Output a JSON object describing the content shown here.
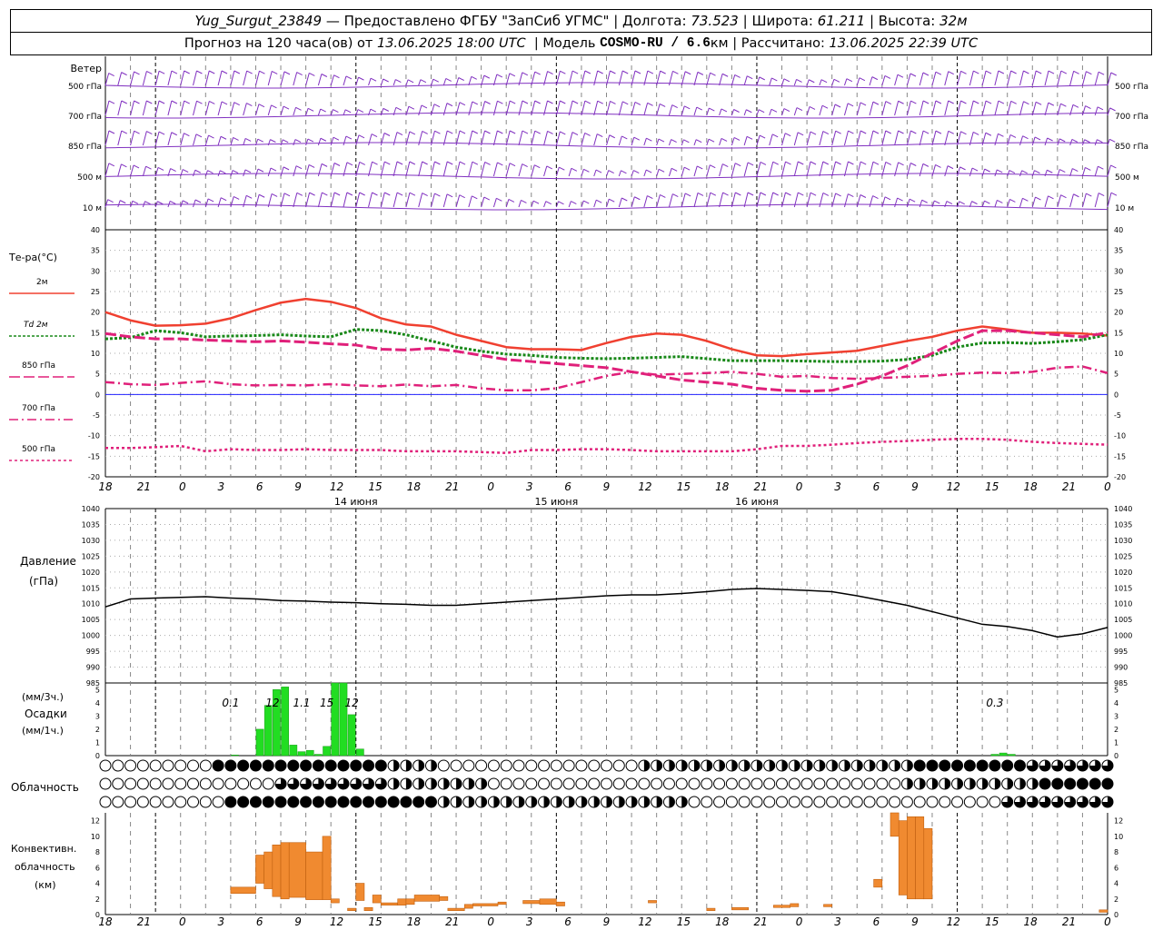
{
  "header": {
    "station": "Yug_Surgut_23849",
    "provider": "— Предоставлено ФГБУ \"ЗапСиб УГМС\"",
    "lon_label": "Долгота:",
    "lon": "73.523",
    "lat_label": "Широта:",
    "lat": "61.211",
    "alt_label": "Высота:",
    "alt": "32м",
    "forecast_prefix": "Прогноз на 120 часа(ов) от",
    "forecast_time": "13.06.2025 18:00 UTC",
    "model_label": "Модель",
    "model": "COSMO-RU / 6.6",
    "model_unit": "км",
    "calc_label": "Рассчитано:",
    "calc_time": "13.06.2025 22:39 UTC"
  },
  "colors": {
    "wind": "#8030c0",
    "t2m": "#f04030",
    "td2m": "#188818",
    "t850": "#e0207a",
    "precip": "#22dd22",
    "conv": "#f08a30",
    "pressure": "#000000",
    "zero_line": "#2020ff"
  },
  "time_axis": {
    "ticks": [
      "18",
      "21",
      "0",
      "3",
      "6",
      "9",
      "12",
      "15",
      "18",
      "21",
      "0",
      "3",
      "6",
      "9",
      "12",
      "15",
      "18",
      "21",
      "0",
      "3",
      "6",
      "9",
      "12",
      "15",
      "18",
      "21",
      "0"
    ],
    "days": [
      "14 июня",
      "15 июня",
      "16 июня"
    ]
  },
  "wind": {
    "title": "Ветер",
    "levels": [
      "500 гПа",
      "700 гПа",
      "850 гПа",
      "500 м",
      "10 м"
    ]
  },
  "temperature": {
    "ylabel": "Те-ра(°C)",
    "ylim": [
      -20,
      40
    ],
    "ticks": [
      40,
      35,
      30,
      25,
      20,
      15,
      10,
      5,
      0,
      -5,
      -10,
      -15,
      -20
    ],
    "legend": [
      "2м",
      "Td 2м",
      "850 гПа",
      "700 гПа",
      "500 гПа"
    ]
  },
  "pressure": {
    "ylabel": "Давление",
    "unit": "(гПа)",
    "ylim": [
      985,
      1040
    ],
    "ticks": [
      1040,
      1035,
      1030,
      1025,
      1020,
      1015,
      1010,
      1005,
      1000,
      995,
      990,
      985
    ]
  },
  "precip": {
    "ylabel1": "(мм/3ч.)",
    "ylabel2": "Осадки",
    "ylabel3": "(мм/1ч.)",
    "ylim": [
      0,
      5.5
    ],
    "ticks": [
      5,
      4,
      3,
      2,
      1,
      0
    ],
    "labels": [
      {
        "text": "0.1",
        "hour": 15
      },
      {
        "text": "12",
        "hour": 20
      },
      {
        "text": "1.1",
        "hour": 23.5
      },
      {
        "text": "15",
        "hour": 26.5
      },
      {
        "text": "12",
        "hour": 29.5
      },
      {
        "text": "0.3",
        "hour": 106.5
      }
    ]
  },
  "clouds": {
    "label": "Облачность",
    "rows": 3
  },
  "convective": {
    "ylabel1": "Конвективн.",
    "ylabel2": "облачность",
    "ylabel3": "(км)",
    "ylim": [
      0,
      13
    ],
    "ticks": [
      12,
      10,
      8,
      6,
      4,
      2,
      0
    ]
  },
  "chart_data": [
    {
      "type": "line",
      "name": "temperature",
      "x_unit": "hours since 13.06.2025 18:00 UTC",
      "series": [
        {
          "name": "2м",
          "x": [
            0,
            3,
            6,
            9,
            12,
            15,
            18,
            21,
            24,
            27,
            30,
            33,
            36,
            39,
            42,
            45,
            48,
            51,
            54,
            57,
            60,
            63,
            66,
            69,
            72,
            75,
            78,
            81,
            84,
            87,
            90,
            93,
            96,
            99,
            102,
            105,
            108,
            111,
            114,
            117,
            120
          ],
          "values": [
            20,
            18,
            16.7,
            16.8,
            17.2,
            18.5,
            20.5,
            22.3,
            23.2,
            22.5,
            21,
            18.5,
            17,
            16.5,
            14.5,
            13,
            11.5,
            11,
            11,
            10.8,
            12.5,
            14,
            14.8,
            14.5,
            13,
            11,
            9.5,
            9.3,
            9.8,
            10.2,
            10.6,
            11.8,
            13,
            14,
            15.5,
            16.5,
            15.8,
            15,
            15,
            14.8,
            14.3
          ]
        },
        {
          "name": "Td 2м",
          "x": [
            0,
            3,
            6,
            9,
            12,
            15,
            18,
            21,
            24,
            27,
            30,
            33,
            36,
            39,
            42,
            45,
            48,
            51,
            54,
            57,
            60,
            63,
            66,
            69,
            72,
            75,
            78,
            81,
            84,
            87,
            90,
            93,
            96,
            99,
            102,
            105,
            108,
            111,
            114,
            117,
            120
          ],
          "values": [
            13.5,
            13.8,
            15.5,
            15,
            14,
            14.2,
            14.3,
            14.5,
            14.2,
            14,
            15.8,
            15.5,
            14.5,
            13,
            11.5,
            10.5,
            9.8,
            9.5,
            9,
            8.8,
            8.7,
            8.8,
            9,
            9.2,
            8.7,
            8.2,
            8.2,
            8.2,
            8.1,
            8,
            8,
            8.1,
            8.5,
            9.5,
            11.5,
            12.5,
            12.6,
            12.4,
            12.8,
            13.3,
            14.5
          ]
        },
        {
          "name": "850 гПа",
          "x": [
            0,
            3,
            6,
            9,
            12,
            15,
            18,
            21,
            24,
            27,
            30,
            33,
            36,
            39,
            42,
            45,
            48,
            51,
            54,
            57,
            60,
            63,
            66,
            69,
            72,
            75,
            78,
            81,
            84,
            87,
            90,
            93,
            96,
            99,
            102,
            105,
            108,
            111,
            114,
            117,
            120
          ],
          "values": [
            14.8,
            14,
            13.5,
            13.5,
            13.2,
            13,
            12.8,
            13,
            12.7,
            12.3,
            12,
            11,
            10.8,
            11.2,
            10.5,
            9.5,
            8.5,
            8,
            7.5,
            7,
            6.5,
            5.5,
            4.5,
            3.5,
            3,
            2.5,
            1.5,
            1,
            0.8,
            1,
            2.5,
            4.5,
            7,
            10,
            13,
            15.5,
            15.5,
            15,
            14.5,
            14,
            15
          ]
        },
        {
          "name": "700 гПа",
          "x": [
            0,
            3,
            6,
            9,
            12,
            15,
            18,
            21,
            24,
            27,
            30,
            33,
            36,
            39,
            42,
            45,
            48,
            51,
            54,
            57,
            60,
            63,
            66,
            69,
            72,
            75,
            78,
            81,
            84,
            87,
            90,
            93,
            96,
            99,
            102,
            105,
            108,
            111,
            114,
            117,
            120
          ],
          "values": [
            3,
            2.5,
            2.3,
            2.8,
            3.2,
            2.5,
            2.2,
            2.3,
            2.2,
            2.5,
            2.2,
            2,
            2.4,
            2,
            2.3,
            1.5,
            1,
            1,
            1.5,
            3,
            4.5,
            5.5,
            4.8,
            5,
            5.2,
            5.5,
            5,
            4.3,
            4.5,
            4,
            3.8,
            4,
            4.3,
            4.5,
            5,
            5.3,
            5.2,
            5.5,
            6.5,
            6.8,
            5.2
          ]
        },
        {
          "name": "500 гПа",
          "x": [
            0,
            3,
            6,
            9,
            12,
            15,
            18,
            21,
            24,
            27,
            30,
            33,
            36,
            39,
            42,
            45,
            48,
            51,
            54,
            57,
            60,
            63,
            66,
            69,
            72,
            75,
            78,
            81,
            84,
            87,
            90,
            93,
            96,
            99,
            102,
            105,
            108,
            111,
            114,
            117,
            120
          ],
          "values": [
            -13,
            -13,
            -12.8,
            -12.5,
            -13.8,
            -13.3,
            -13.5,
            -13.5,
            -13.3,
            -13.5,
            -13.5,
            -13.5,
            -13.8,
            -13.8,
            -13.8,
            -14,
            -14.2,
            -13.5,
            -13.5,
            -13.3,
            -13.3,
            -13.5,
            -13.8,
            -13.8,
            -13.8,
            -13.8,
            -13.3,
            -12.5,
            -12.5,
            -12.2,
            -11.8,
            -11.5,
            -11.3,
            -11,
            -10.8,
            -10.8,
            -11,
            -11.5,
            -11.8,
            -12,
            -12.2
          ]
        }
      ]
    },
    {
      "type": "line",
      "name": "pressure",
      "x_unit": "hours since 13.06.2025 18:00 UTC",
      "series": [
        {
          "name": "pressure",
          "x": [
            0,
            3,
            6,
            9,
            12,
            15,
            18,
            21,
            24,
            27,
            30,
            33,
            36,
            39,
            42,
            45,
            48,
            51,
            54,
            57,
            60,
            63,
            66,
            69,
            72,
            75,
            78,
            81,
            84,
            87,
            90,
            93,
            96,
            99,
            102,
            105,
            108,
            111,
            114,
            117,
            120
          ],
          "values": [
            1009,
            1011.5,
            1011.8,
            1012,
            1012.2,
            1011.8,
            1011.5,
            1011,
            1010.8,
            1010.5,
            1010.3,
            1010,
            1009.8,
            1009.5,
            1009.5,
            1010,
            1010.5,
            1011,
            1011.5,
            1012,
            1012.5,
            1012.8,
            1012.8,
            1013.2,
            1013.8,
            1014.5,
            1014.8,
            1014.5,
            1014.2,
            1013.8,
            1012.5,
            1011,
            1009.5,
            1007.5,
            1005.5,
            1003.5,
            1002.8,
            1001.5,
            999.5,
            1000.5,
            1002.5
          ]
        }
      ]
    },
    {
      "type": "bar",
      "name": "precipitation",
      "x_unit": "hours since 13.06.2025 18:00 UTC",
      "x": [
        15,
        18,
        19,
        20,
        21,
        22,
        23,
        24,
        25,
        26,
        27,
        28,
        29,
        30,
        106,
        107,
        108
      ],
      "values": [
        0.05,
        2,
        3.8,
        5,
        5.2,
        0.8,
        0.3,
        0.4,
        0.1,
        0.7,
        5.5,
        5.5,
        3.1,
        0.5,
        0.1,
        0.2,
        0.1
      ]
    },
    {
      "type": "bar",
      "name": "convective",
      "x_unit": "hours since 13.06.2025 18:00 UTC",
      "bars": [
        [
          15,
          18,
          2.7,
          3.5
        ],
        [
          18,
          19,
          4,
          7.6
        ],
        [
          19,
          20,
          3.3,
          8
        ],
        [
          20,
          21,
          2.3,
          8.9
        ],
        [
          21,
          22,
          2,
          9.2
        ],
        [
          22,
          24,
          2.2,
          9.2
        ],
        [
          24,
          26,
          1.9,
          8
        ],
        [
          26,
          27,
          1.9,
          10
        ],
        [
          27,
          28,
          1.5,
          2
        ],
        [
          29,
          30,
          0.5,
          0.8
        ],
        [
          30,
          31,
          1.8,
          4
        ],
        [
          31,
          32,
          0.5,
          0.9
        ],
        [
          32,
          33,
          1.5,
          2.5
        ],
        [
          33,
          35,
          1.2,
          1.5
        ],
        [
          35,
          36,
          1.2,
          2
        ],
        [
          36,
          37,
          1.3,
          2
        ],
        [
          37,
          40,
          1.7,
          2.5
        ],
        [
          40,
          41,
          1.8,
          2.3
        ],
        [
          41,
          43,
          0.5,
          0.8
        ],
        [
          43,
          44,
          0.8,
          1.3
        ],
        [
          44,
          47,
          1.1,
          1.4
        ],
        [
          47,
          48,
          1.3,
          1.6
        ],
        [
          50,
          52,
          1.4,
          1.8
        ],
        [
          52,
          54,
          1.3,
          2
        ],
        [
          54,
          55,
          1.1,
          1.6
        ],
        [
          65,
          66,
          1.5,
          1.8
        ],
        [
          72,
          73,
          0.5,
          0.8
        ],
        [
          75,
          77,
          0.6,
          0.9
        ],
        [
          80,
          82,
          0.9,
          1.2
        ],
        [
          82,
          83,
          1,
          1.4
        ],
        [
          86,
          87,
          1,
          1.3
        ],
        [
          92,
          93,
          3.5,
          4.5
        ],
        [
          94,
          95,
          10,
          13
        ],
        [
          95,
          96,
          2.5,
          12
        ],
        [
          96,
          97,
          2,
          12.5
        ],
        [
          97,
          98,
          2,
          12.5
        ],
        [
          98,
          99,
          2,
          11
        ],
        [
          119,
          120,
          0.3,
          0.6
        ]
      ]
    }
  ]
}
